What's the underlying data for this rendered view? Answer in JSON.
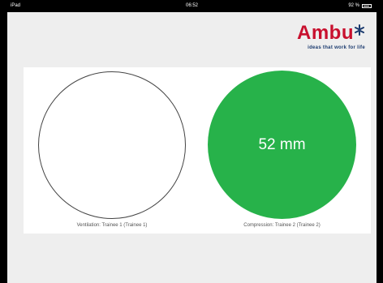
{
  "status_bar": {
    "carrier": "iPad",
    "time": "06:52",
    "right_text": "92 %"
  },
  "logo": {
    "wordmark": "Ambu",
    "tagline": "ideas that work for life",
    "brand_color": "#c8102e",
    "tagline_color": "#1a3a6e"
  },
  "ventilation": {
    "value": "",
    "caption": "Ventilation: Trainee 1 (Trainee 1)"
  },
  "compression": {
    "value": "52 mm",
    "caption": "Compression: Trainee 2 (Trainee 2)",
    "color": "#27b24a"
  }
}
